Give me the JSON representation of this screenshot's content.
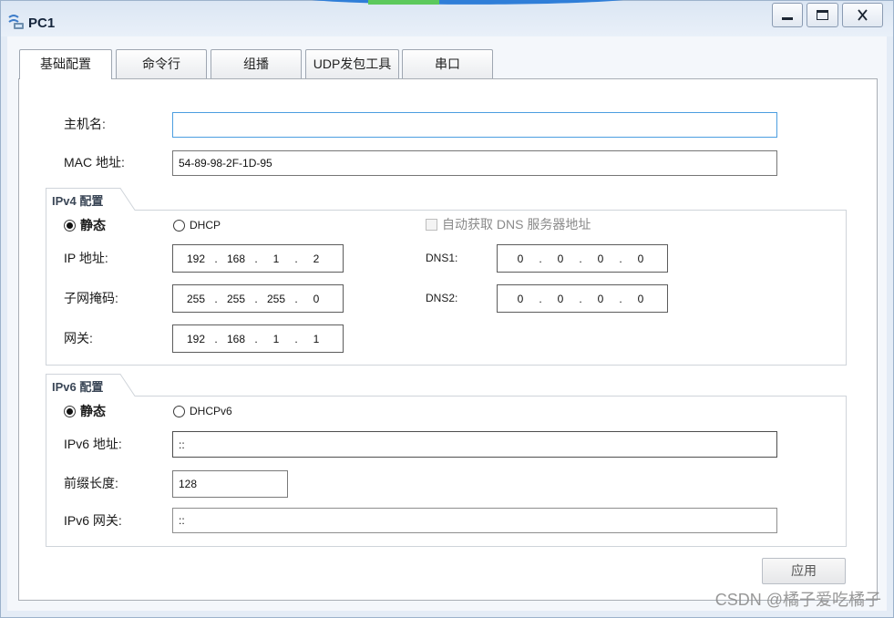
{
  "window": {
    "title": "PC1",
    "icon": "pc-icon",
    "controls": [
      "minimize-icon",
      "maximize-icon",
      "close-icon"
    ]
  },
  "tabs": [
    {
      "label": "基础配置",
      "active": true
    },
    {
      "label": "命令行",
      "active": false
    },
    {
      "label": "组播",
      "active": false
    },
    {
      "label": "UDP发包工具",
      "active": false
    },
    {
      "label": "串口",
      "active": false
    }
  ],
  "basic": {
    "hostname": {
      "label": "主机名:",
      "value": ""
    },
    "mac": {
      "label": "MAC 地址:",
      "value": "54-89-98-2F-1D-95"
    }
  },
  "ipv4": {
    "title": "IPv4 配置",
    "octet_separator": ".",
    "static": {
      "label": "静态",
      "checked": true
    },
    "dhcp": {
      "label": "DHCP",
      "checked": false
    },
    "auto_dns": {
      "label": "自动获取 DNS 服务器地址",
      "checked": false,
      "enabled": false
    },
    "ip": {
      "label": "IP 地址:",
      "octets": [
        "192",
        "168",
        "1",
        "2"
      ]
    },
    "mask": {
      "label": "子网掩码:",
      "octets": [
        "255",
        "255",
        "255",
        "0"
      ]
    },
    "gateway": {
      "label": "网关:",
      "octets": [
        "192",
        "168",
        "1",
        "1"
      ]
    },
    "dns1": {
      "label": "DNS1:",
      "octets": [
        "0",
        "0",
        "0",
        "0"
      ]
    },
    "dns2": {
      "label": "DNS2:",
      "octets": [
        "0",
        "0",
        "0",
        "0"
      ]
    }
  },
  "ipv6": {
    "title": "IPv6 配置",
    "static": {
      "label": "静态",
      "checked": true
    },
    "dhcp": {
      "label": "DHCPv6",
      "checked": false
    },
    "address": {
      "label": "IPv6 地址:",
      "value": "::"
    },
    "prefix_length": {
      "label": "前缀长度:",
      "value": "128"
    },
    "gateway": {
      "label": "IPv6 网关:",
      "value": "::"
    }
  },
  "actions": {
    "apply_label": "应用"
  },
  "watermark": "CSDN @橘子爱吃橘子",
  "colors": {
    "title_bar": "#dbe6f3",
    "focus_border": "#4c9ee0",
    "field_border": "#6b6b6b",
    "panel_border": "#a9aeb5",
    "section_border": "#cfd4da",
    "disabled_text": "#8a8a8a"
  }
}
